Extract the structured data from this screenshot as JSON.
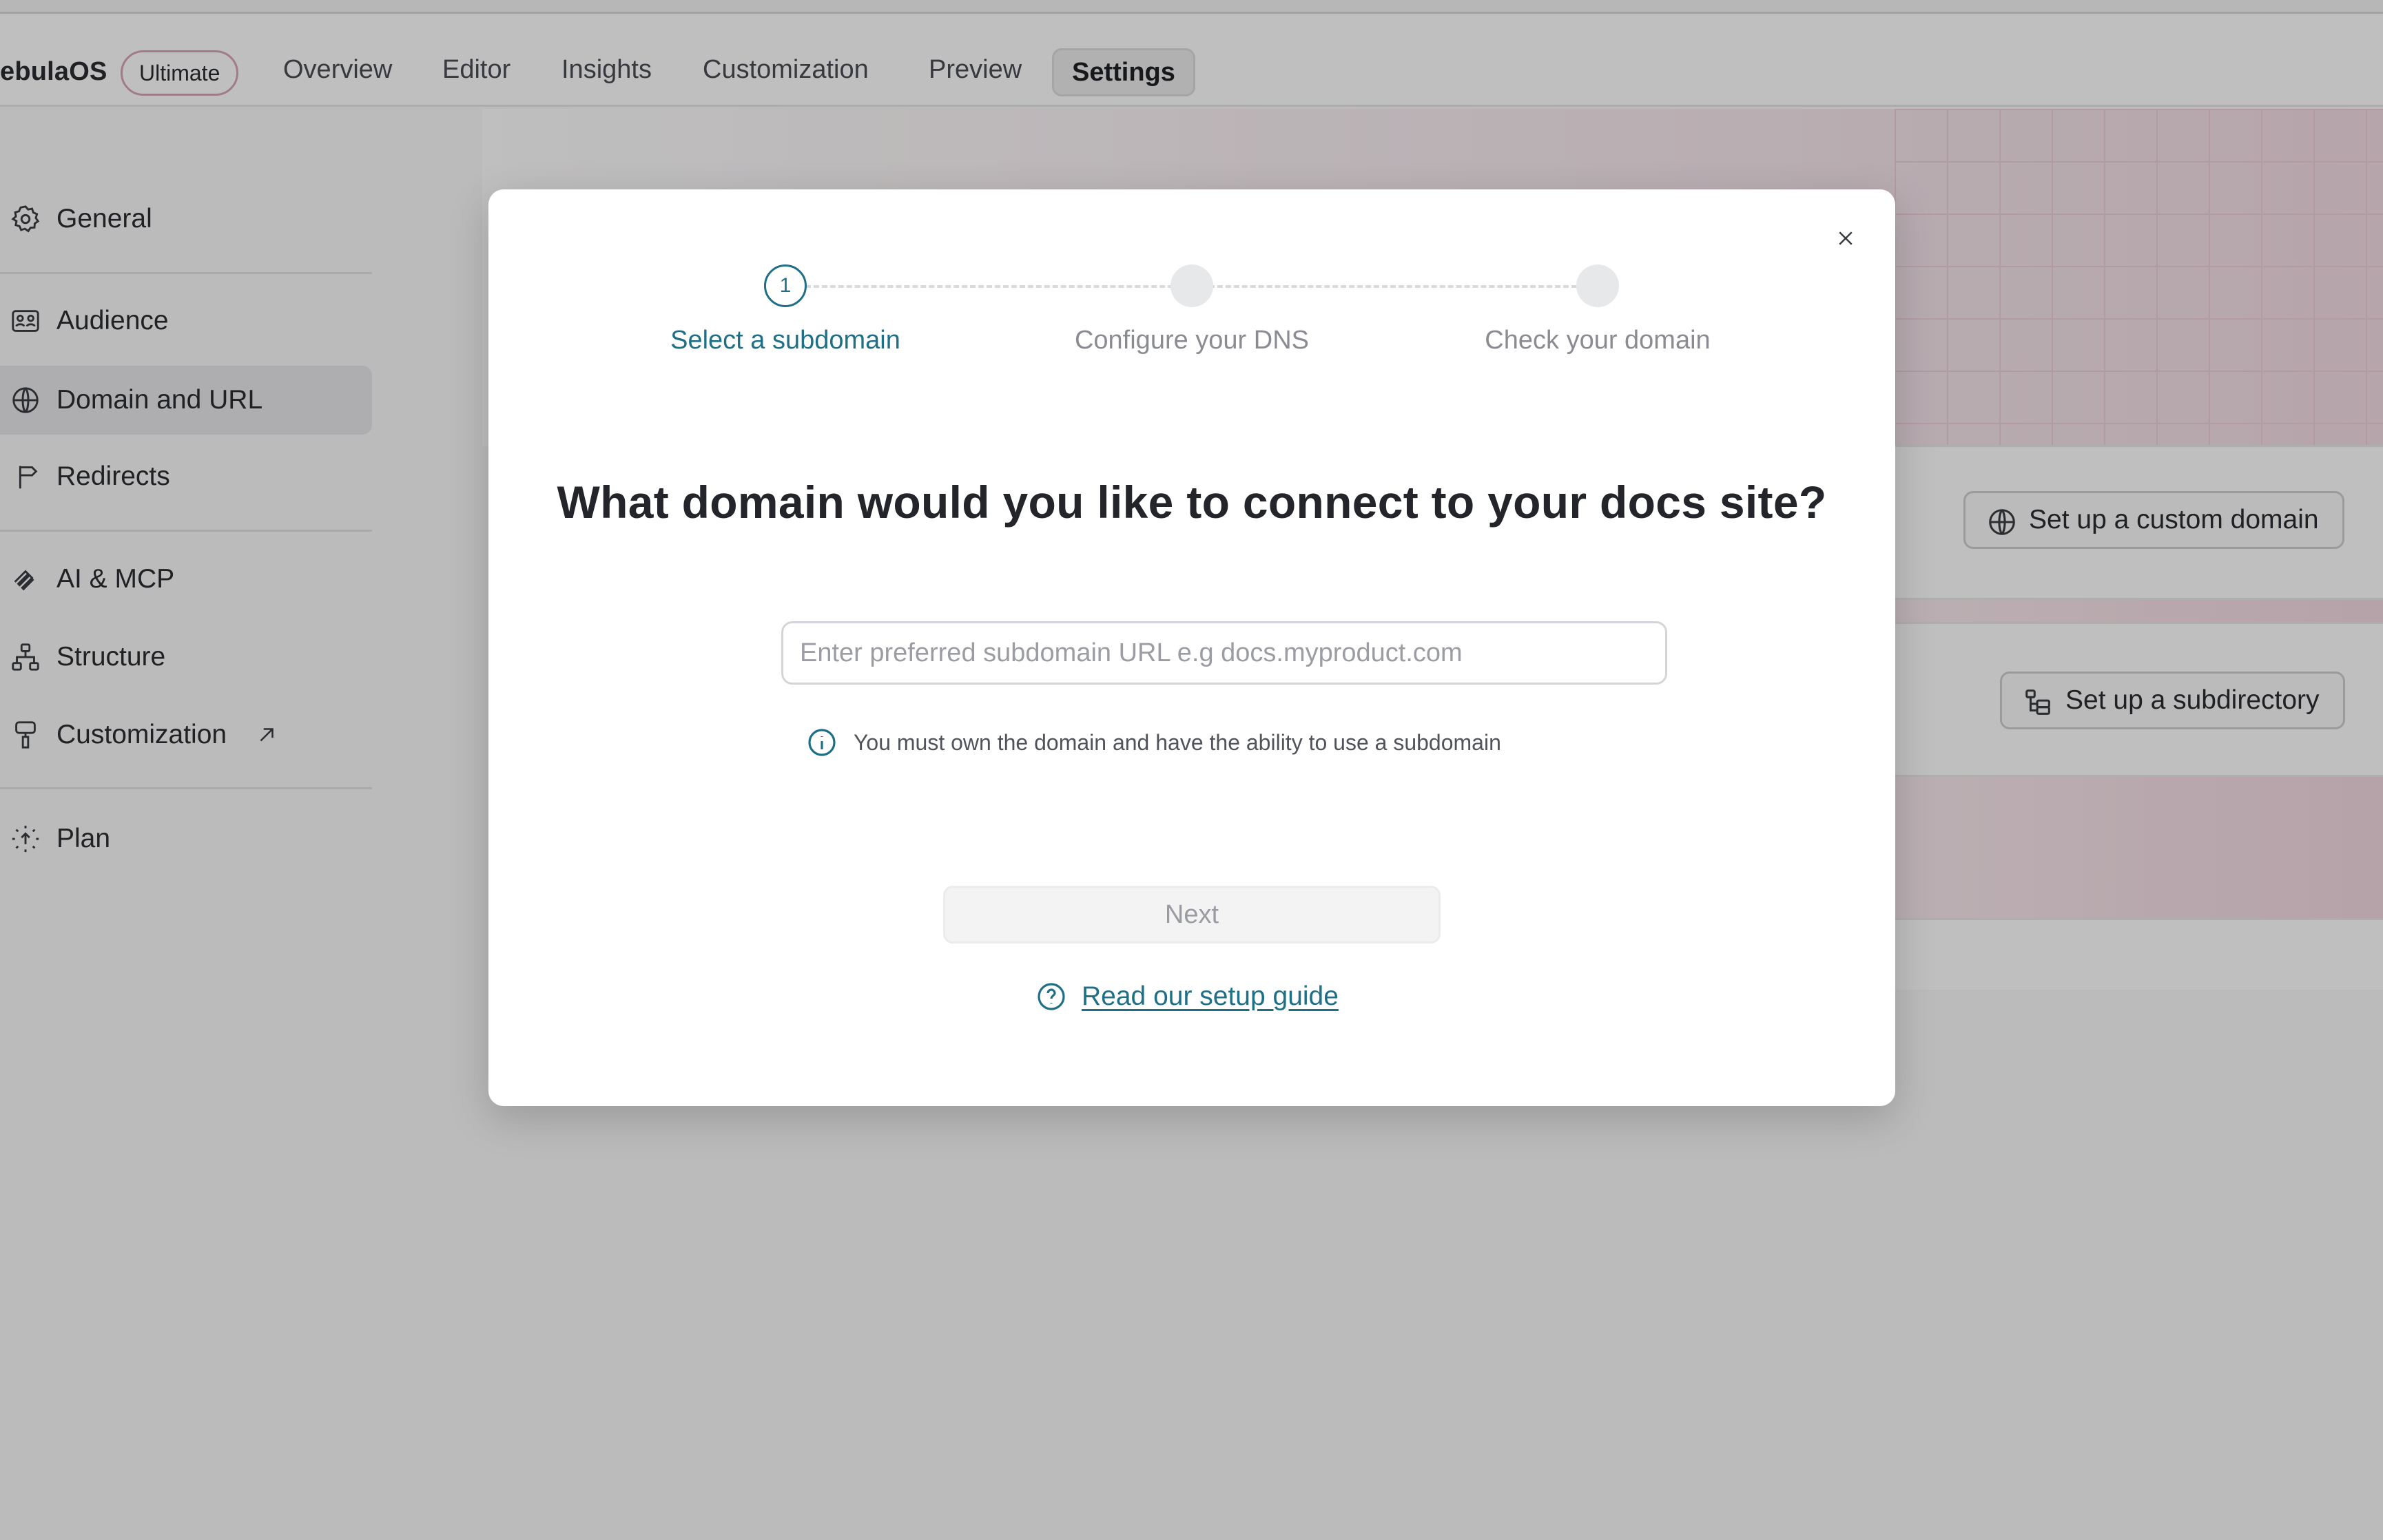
{
  "header": {
    "brand": "ebulaOS",
    "plan_badge": "Ultimate",
    "tabs": [
      {
        "label": "Overview"
      },
      {
        "label": "Editor"
      },
      {
        "label": "Insights"
      },
      {
        "label": "Customization"
      },
      {
        "label": "Preview"
      },
      {
        "label": "Settings"
      }
    ]
  },
  "sidebar": {
    "items": [
      {
        "label": "General",
        "icon": "gear-icon"
      },
      {
        "label": "Audience",
        "icon": "audience-icon"
      },
      {
        "label": "Domain and URL",
        "icon": "globe-icon"
      },
      {
        "label": "Redirects",
        "icon": "signpost-icon"
      },
      {
        "label": "AI & MCP",
        "icon": "ai-icon"
      },
      {
        "label": "Structure",
        "icon": "sitemap-icon"
      },
      {
        "label": "Customization",
        "icon": "paint-roller-icon"
      },
      {
        "label": "Plan",
        "icon": "sparkle-icon"
      }
    ]
  },
  "background": {
    "custom_domain_button": "Set up a custom domain",
    "subdirectory_button": "Set up a subdirectory"
  },
  "modal": {
    "steps": [
      {
        "number": "1",
        "label": "Select a subdomain"
      },
      {
        "label": "Configure your DNS"
      },
      {
        "label": "Check your domain"
      }
    ],
    "title": "What domain would you like to connect to your docs site?",
    "input_placeholder": "Enter preferred subdomain URL e.g docs.myproduct.com",
    "input_value": "",
    "hint": "You must own the domain and have the ability to use a subdomain",
    "next_label": "Next",
    "guide_link": "Read our setup guide"
  },
  "colors": {
    "accent": "#1f6f86",
    "overlay": "rgba(0,0,0,0.25)",
    "badge_border": "#d9a5b8"
  }
}
